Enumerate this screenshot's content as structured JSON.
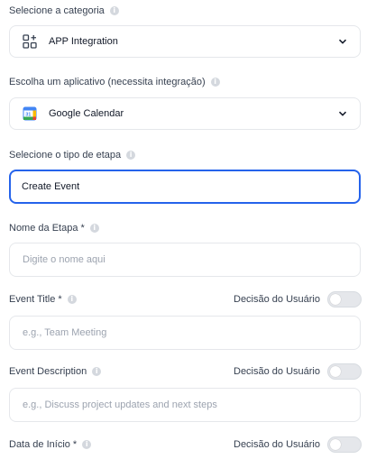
{
  "category": {
    "label": "Selecione a categoria",
    "value": "APP Integration",
    "icon": "app-integration-icon"
  },
  "app": {
    "label": "Escolha um aplicativo (necessita integração)",
    "value": "Google Calendar",
    "icon": "google-calendar-icon",
    "icon_text": "31"
  },
  "step_type": {
    "label": "Selecione o tipo de etapa",
    "value": "Create Event"
  },
  "step_name": {
    "label": "Nome da Etapa *",
    "placeholder": "Digite o nome aqui"
  },
  "event_title": {
    "label": "Event Title *",
    "placeholder": "e.g., Team Meeting",
    "decision_label": "Decisão do Usuário",
    "decision_on": false
  },
  "event_description": {
    "label": "Event Description",
    "placeholder": "e.g., Discuss project updates and next steps",
    "decision_label": "Decisão do Usuário",
    "decision_on": false
  },
  "start_date": {
    "label": "Data de Início *",
    "decision_label": "Decisão do Usuário",
    "decision_on": false
  },
  "colors": {
    "focus_border": "#2563eb",
    "border": "#e5e7eb",
    "placeholder": "#9ca3af"
  }
}
